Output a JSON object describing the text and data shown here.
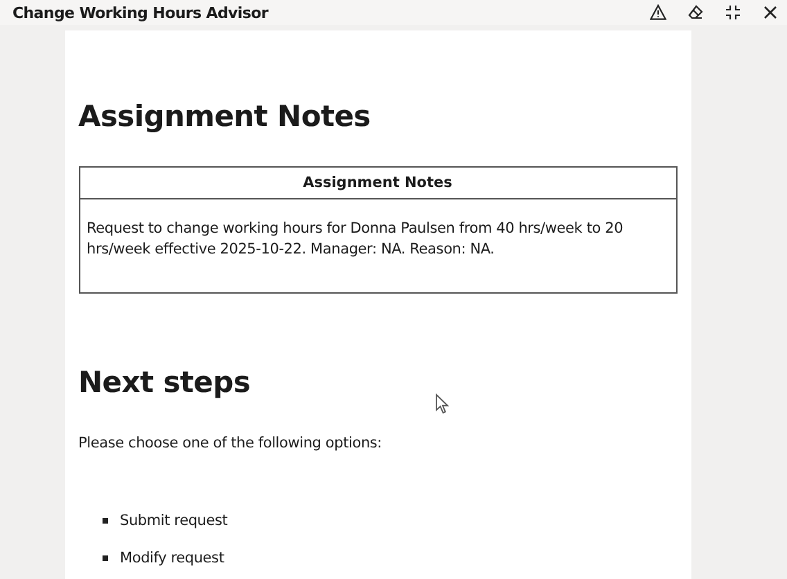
{
  "window": {
    "title": "Change Working Hours Advisor"
  },
  "content": {
    "heading": "Assignment Notes",
    "table": {
      "header": "Assignment Notes",
      "cell": "Request to change working hours for Donna Paulsen from 40 hrs/week to 20 hrs/week effective 2025-10-22. Manager: NA. Reason: NA."
    },
    "next_heading": "Next steps",
    "prompt": "Please choose one of the following options:",
    "options": [
      "Submit request",
      "Modify request"
    ]
  }
}
